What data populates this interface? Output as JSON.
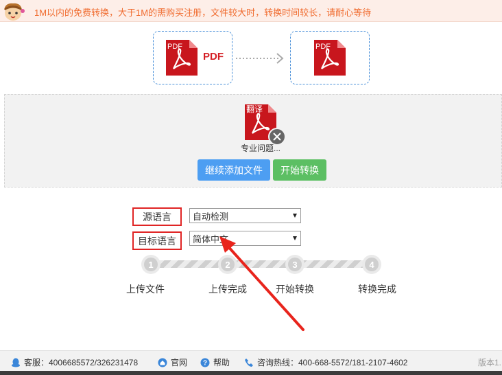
{
  "notice": {
    "text": "1M以内的免费转换，大于1M的需购买注册，文件较大时，转换时间较长，请耐心等待"
  },
  "conversion": {
    "from_badge": "PDF",
    "from_word": "PDF",
    "to_badge": "PDF"
  },
  "file": {
    "badge": "翻译",
    "name": "专业问题..."
  },
  "buttons": {
    "add_files": "继续添加文件",
    "start": "开始转换"
  },
  "language": {
    "source_label": "源语言",
    "source_value": "自动检测",
    "target_label": "目标语言",
    "target_value": "简体中文"
  },
  "steps": [
    {
      "number": "1",
      "label": "上传文件"
    },
    {
      "number": "2",
      "label": "上传完成"
    },
    {
      "number": "3",
      "label": "开始转换"
    },
    {
      "number": "4",
      "label": "转换完成"
    }
  ],
  "footer": {
    "service": "客服：4006685572/326231478",
    "website": "官网",
    "help": "帮助",
    "hotline": "咨询热线：400-668-5572/181-2107-4602",
    "version": "版本1."
  },
  "colors": {
    "pdf_red": "#d41e24",
    "accent_blue": "#4d9ef2",
    "accent_green": "#5cbf63",
    "notice_text": "#f06b2e",
    "highlight_red": "#e02424"
  },
  "icons": {
    "notice": "mascot-icon",
    "service": "qq-penguin-icon",
    "website": "home-icon",
    "help": "question-icon",
    "hotline": "phone-icon",
    "remove": "close-icon"
  }
}
